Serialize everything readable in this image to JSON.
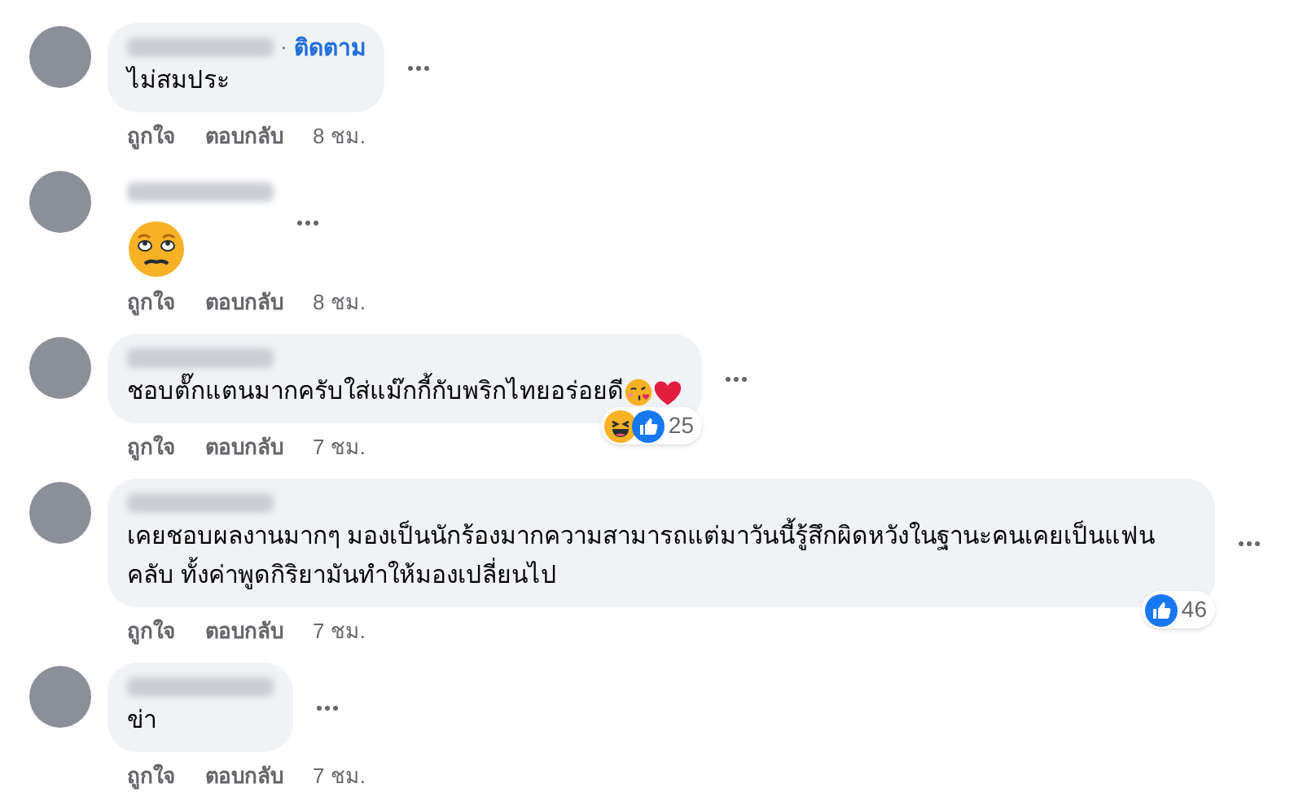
{
  "comments": [
    {
      "kind": "text",
      "separator": "·",
      "follow": "ติดตาม",
      "text": "ไม่สมประ",
      "actions": {
        "like": "ถูกใจ",
        "reply": "ตอบกลับ",
        "time": "8 ชม."
      }
    },
    {
      "kind": "sticker",
      "actions": {
        "like": "ถูกใจ",
        "reply": "ตอบกลับ",
        "time": "8 ชม."
      }
    },
    {
      "kind": "text",
      "text": "ชอบตั๊กแตนมากครับใส่แม๊กกี้กับพริกไทยอร่อยดี",
      "emoji_suffix": true,
      "reactions": {
        "kind": "haha_like",
        "count": "25"
      },
      "actions": {
        "like": "ถูกใจ",
        "reply": "ตอบกลับ",
        "time": "7 ชม."
      }
    },
    {
      "kind": "text",
      "text": "เคยชอบผลงานมากๆ มองเป็นนักร้องมากความสามารถแต่มาวันนี้รู้สึกผิดหวังในฐานะคนเคยเป็นแฟนคลับ ทั้งค่าพูดกิริยามันทำให้มองเปลี่ยนไป",
      "reactions": {
        "kind": "like",
        "count": "46"
      },
      "actions": {
        "like": "ถูกใจ",
        "reply": "ตอบกลับ",
        "time": "7 ชม."
      }
    },
    {
      "kind": "text",
      "text": "ข่า",
      "actions": {
        "like": "ถูกใจ",
        "reply": "ตอบกลับ",
        "time": "7 ชม."
      }
    }
  ]
}
